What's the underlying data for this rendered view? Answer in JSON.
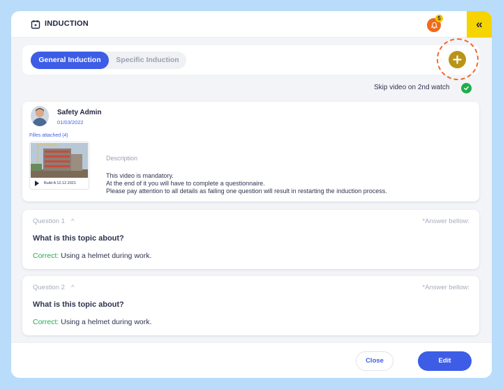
{
  "header": {
    "title": "INDUCTION",
    "title_icon": "calendar-play-icon",
    "notification_count": "5",
    "collapse_label": "«"
  },
  "tabs": [
    {
      "label": "General Induction",
      "active": true
    },
    {
      "label": "Specific Induction",
      "active": false
    }
  ],
  "skip_video": {
    "label": "Skip video on 2nd watch",
    "checked": true
  },
  "post": {
    "author": "Safety Admin",
    "date": "01/03/2022",
    "files_label": "Filles attached (4)",
    "attachment_caption": "Build A 12.12.2021",
    "description_label": "Description",
    "description_lines": [
      "This video is mandatory.",
      "At the end of it you will have to complete a questionnaire.",
      "Please pay attention to all details as failing one question will result in restarting the induction process."
    ]
  },
  "questions": [
    {
      "number": "Question 1",
      "answer_note": "*Answer bellow:",
      "text": "What is this topic about?",
      "correct_label": "Correct:",
      "correct_answer": " Using a helmet during work."
    },
    {
      "number": "Question 2",
      "answer_note": "*Answer bellow:",
      "text": "What is this topic about?",
      "correct_label": "Correct:",
      "correct_answer": " Using a helmet during work."
    }
  ],
  "footer": {
    "close_label": "Close",
    "edit_label": "Edit"
  },
  "colors": {
    "primary": "#3d5de6",
    "accent_yellow": "#f5d400",
    "success": "#1fae4b",
    "notification": "#f06a18",
    "add_button": "#b89418"
  }
}
